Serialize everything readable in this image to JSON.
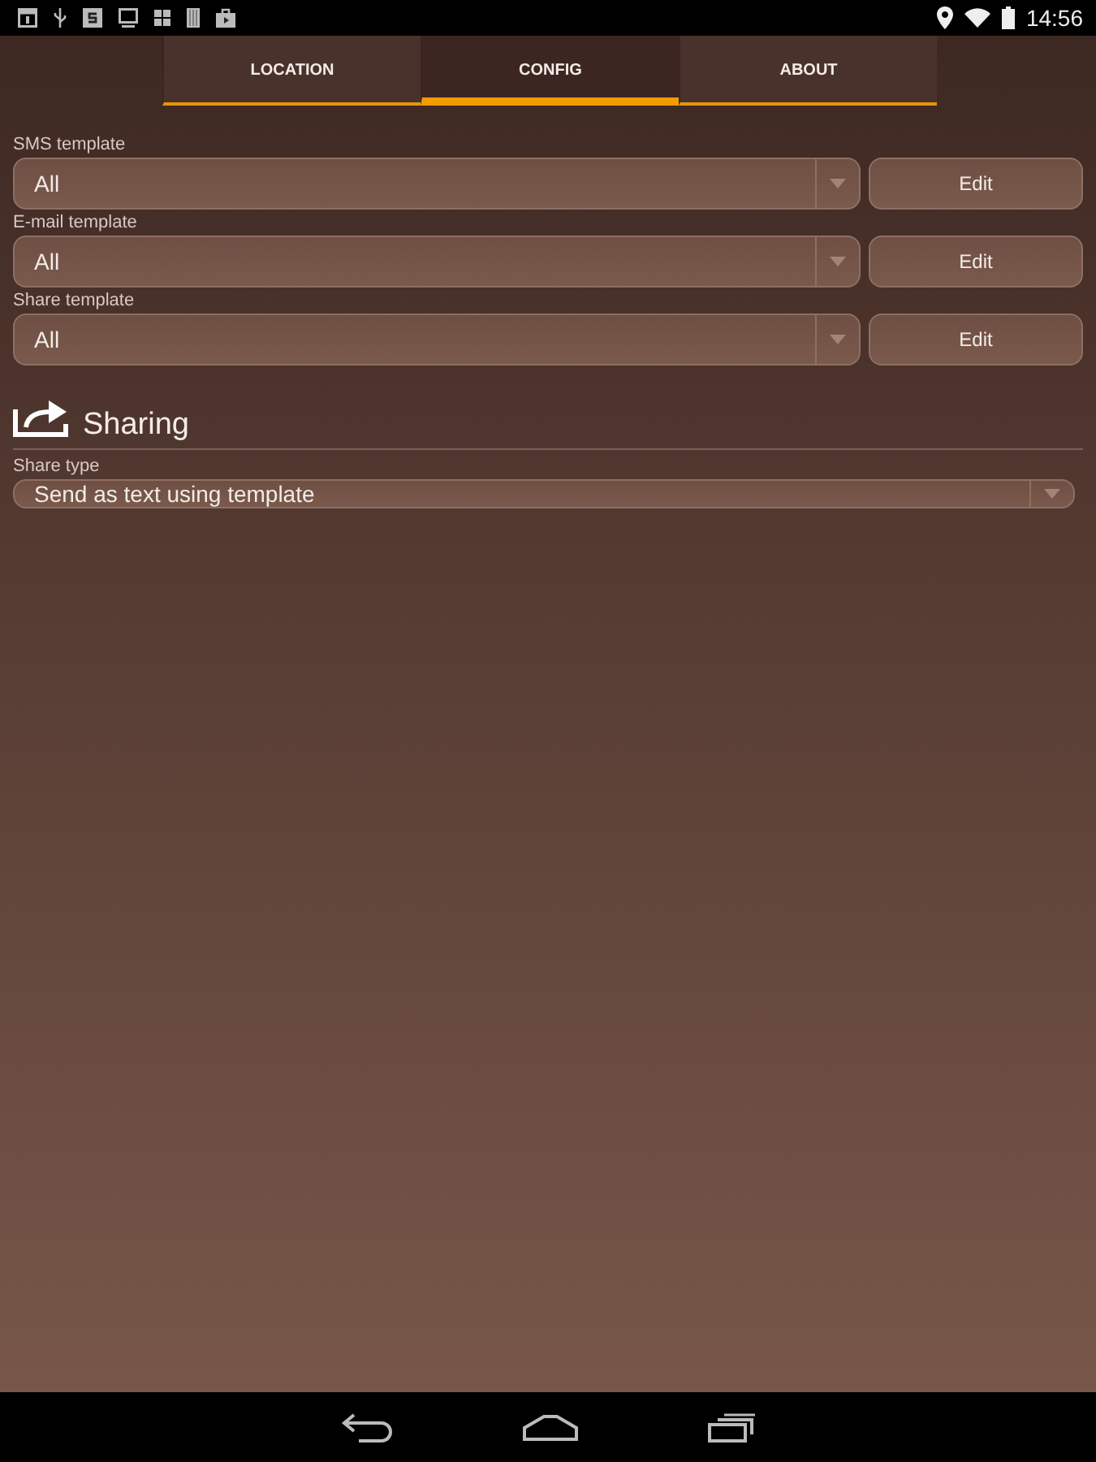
{
  "status_bar": {
    "time": "14:56"
  },
  "tabs": [
    {
      "label": "LOCATION",
      "selected": false
    },
    {
      "label": "CONFIG",
      "selected": true
    },
    {
      "label": "ABOUT",
      "selected": false
    }
  ],
  "templates": [
    {
      "label": "SMS template",
      "value": "All",
      "button": "Edit"
    },
    {
      "label": "E-mail template",
      "value": "All",
      "button": "Edit"
    },
    {
      "label": "Share template",
      "value": "All",
      "button": "Edit"
    }
  ],
  "sharing": {
    "title": "Sharing",
    "fields": [
      {
        "label": "Share type",
        "value": "Send as text using template"
      }
    ]
  }
}
